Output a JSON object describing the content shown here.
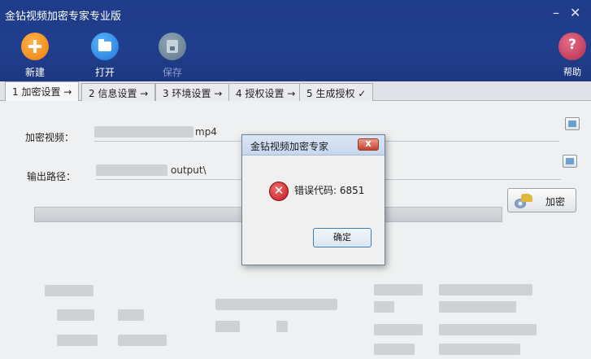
{
  "app": {
    "title": "金钻视频加密专家专业版"
  },
  "toolbar": {
    "new_label": "新建",
    "open_label": "打开",
    "save_label": "保存",
    "help_label": "帮助"
  },
  "tabs": [
    {
      "label": "1 加密设置 →"
    },
    {
      "label": "2 信息设置 →"
    },
    {
      "label": "3 环境设置 →"
    },
    {
      "label": "4 授权设置 →"
    },
    {
      "label": "5 生成授权 ✓"
    }
  ],
  "form": {
    "video_label": "加密视频：",
    "video_path_suffix": "mp4",
    "output_label": "输出路径：",
    "output_path_suffix": "output\\",
    "encrypt_label": "加密"
  },
  "dialog": {
    "title": "金钻视频加密专家",
    "message": "错误代码: 6851",
    "ok_label": "确定"
  },
  "icons": {
    "new": "plus-icon",
    "open": "folder-icon",
    "save": "floppy-icon",
    "help": "question-icon",
    "error": "error-x-icon"
  },
  "colors": {
    "header_bg": "#213e8e",
    "new_orange": "#e9820e",
    "open_blue": "#1d78d6",
    "help_red": "#b42a4c",
    "error_red": "#c0181f"
  }
}
